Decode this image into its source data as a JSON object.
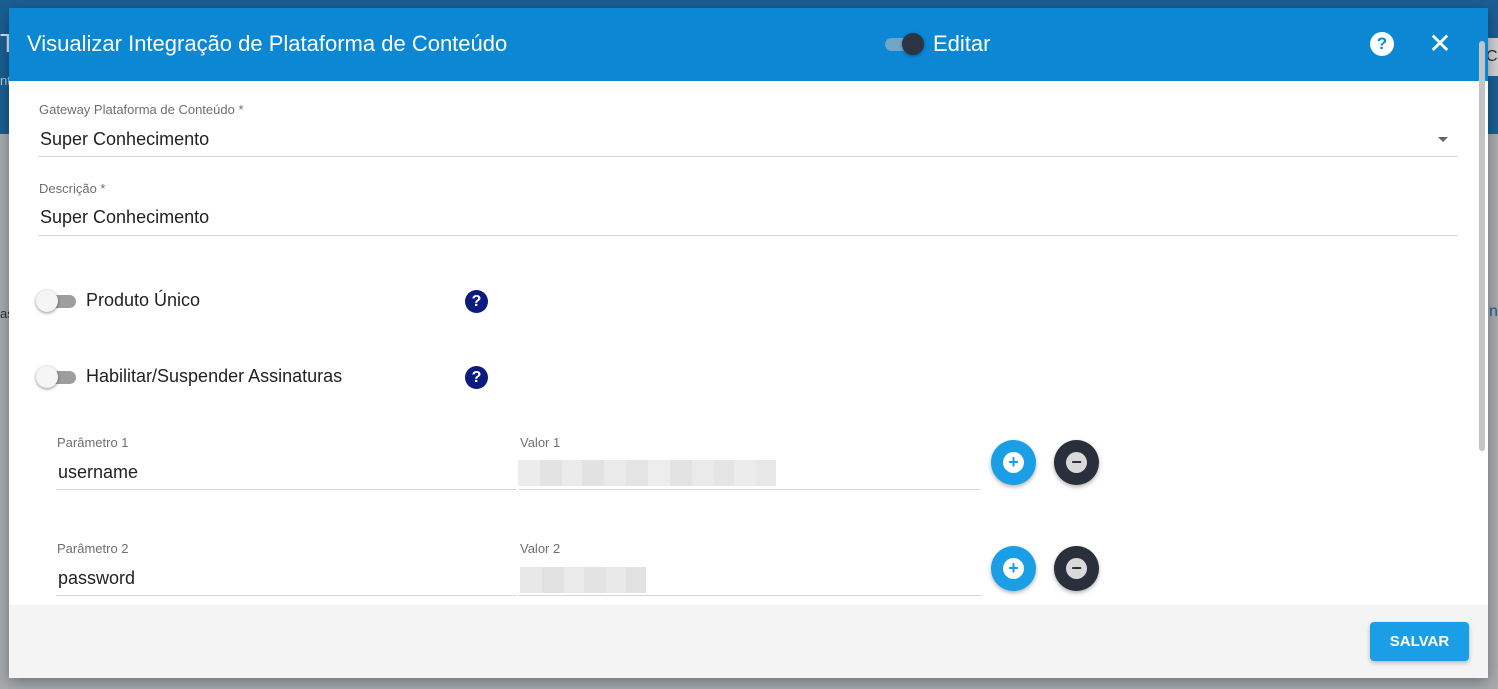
{
  "background": {
    "title_fragment": "Ta",
    "subtitle_fragment": "nt",
    "right_box_fragment": "Cl",
    "left_fragment": "as",
    "right_fragment": "n"
  },
  "modal": {
    "title": "Visualizar Integração de Plataforma de Conteúdo",
    "edit_label": "Editar",
    "help_glyph": "?",
    "close_glyph": "✕"
  },
  "form": {
    "gateway": {
      "label": "Gateway Plataforma de Conteúdo *",
      "value": "Super Conhecimento"
    },
    "descricao": {
      "label": "Descrição *",
      "value": "Super Conhecimento"
    },
    "produto_unico": {
      "label": "Produto Único",
      "help": "?"
    },
    "assinaturas": {
      "label": "Habilitar/Suspender Assinaturas",
      "help": "?"
    },
    "params": [
      {
        "param_label": "Parâmetro 1",
        "param_value": "username",
        "valor_label": "Valor 1"
      },
      {
        "param_label": "Parâmetro 2",
        "param_value": "password",
        "valor_label": "Valor 2"
      }
    ]
  },
  "buttons": {
    "add_glyph": "+",
    "remove_glyph": "−"
  },
  "footer": {
    "save_label": "SALVAR"
  },
  "colors": {
    "header": "#0b87d4",
    "accent": "#1a9ee6",
    "help_icon": "#0d1a80",
    "remove_button": "#2a2f3c"
  }
}
